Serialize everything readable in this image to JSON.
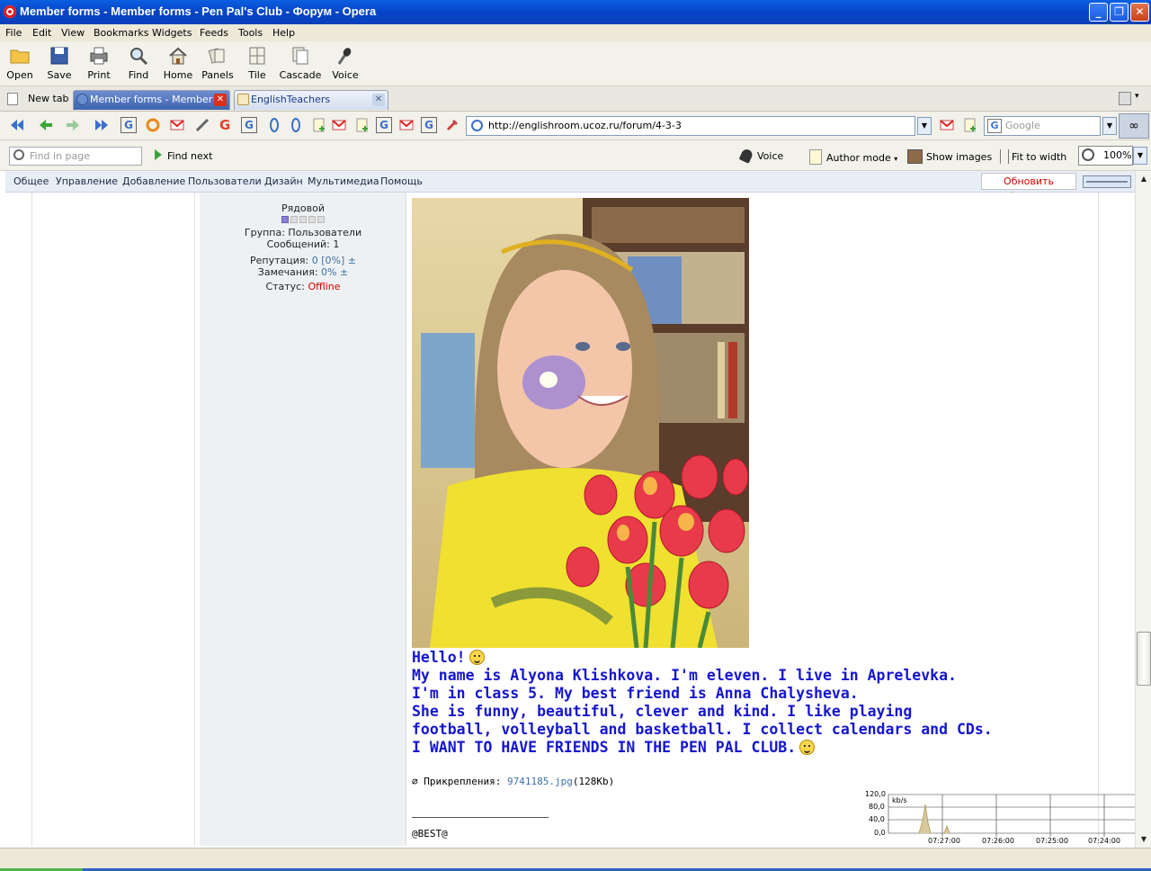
{
  "window": {
    "title": "Member forms - Member forms - Pen Pal's Club - Форум - Opera"
  },
  "menu": [
    "File",
    "Edit",
    "View",
    "Bookmarks",
    "Widgets",
    "Feeds",
    "Tools",
    "Help"
  ],
  "toolbar": {
    "open": "Open",
    "save": "Save",
    "print": "Print",
    "find": "Find",
    "home": "Home",
    "panels": "Panels",
    "tile": "Tile",
    "cascade": "Cascade",
    "voice": "Voice"
  },
  "tabs": {
    "new_tab": "New tab",
    "tab1": "Member forms - Member ...",
    "tab2": "EnglishTeachers"
  },
  "address": {
    "url": "http://englishroom.ucoz.ru/forum/4-3-3",
    "search_placeholder": "Google"
  },
  "viewbar": {
    "find_placeholder": "Find in page",
    "find_next": "Find next",
    "voice": "Voice",
    "author_mode": "Author mode",
    "show_images": "Show images",
    "fit_to_width": "Fit to width",
    "zoom": "100%"
  },
  "site_menu": {
    "items": [
      "Общее",
      "Управление",
      "Добавление",
      "Пользователи",
      "Дизайн",
      "Мультимедиа",
      "Помощь"
    ],
    "update_browser": "Обновить браузер"
  },
  "user": {
    "rank": "Рядовой",
    "group": "Группа: Пользователи",
    "posts": "Сообщений: 1",
    "reputation_label": "Репутация:",
    "reputation_value": "0 [0%]",
    "reputation_pm": "±",
    "warnings_label": "Замечания:",
    "warnings_value": "0%",
    "warnings_pm": "±",
    "status_label": "Статус:",
    "status_value": "Offline"
  },
  "post": {
    "line1": "Hello!",
    "line2": "My name is Alyona Klishkova. I'm eleven. I live in Aprelevka.",
    "line3": "I'm in class 5. My best friend is Anna Chalysheva.",
    "line4": "She is funny, beautiful, clever and kind. I like playing",
    "line5": "football, volleyball and basketball. I collect calendars and CDs.",
    "line6": "I WANT TO HAVE FRIENDS IN THE PEN PAL CLUB.",
    "attach_label": "Прикрепления:",
    "attach_file": "9741185.jpg",
    "attach_size": "(128Kb)",
    "signature": "@BEST@"
  },
  "netgraph": {
    "unit": "kb/s",
    "y_ticks": [
      "120,0",
      "80,0",
      "40,0",
      "0,0"
    ],
    "x_ticks": [
      "07:27:00",
      "07:26:00",
      "07:25:00",
      "07:24:00"
    ]
  }
}
